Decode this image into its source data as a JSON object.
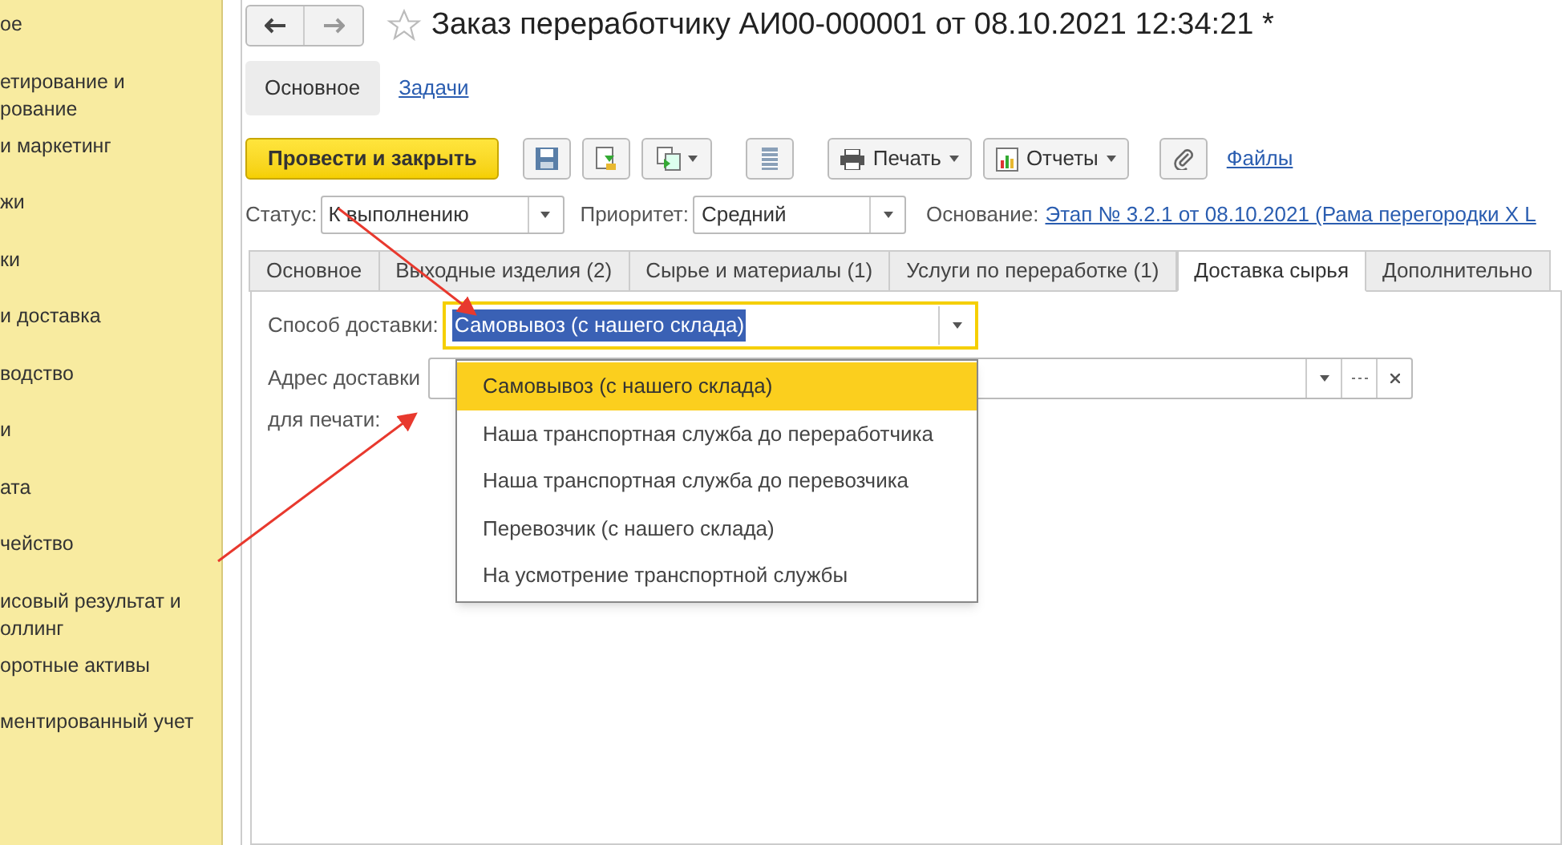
{
  "sidebar": {
    "items": [
      {
        "label": "ое"
      },
      {
        "label": "етирование и рование"
      },
      {
        "label": "и маркетинг"
      },
      {
        "label": "жи"
      },
      {
        "label": "ки"
      },
      {
        "label": "и доставка"
      },
      {
        "label": "водство"
      },
      {
        "label": "и"
      },
      {
        "label": "ата"
      },
      {
        "label": "чейство"
      },
      {
        "label": "исовый результат и оллинг"
      },
      {
        "label": "оротные активы"
      },
      {
        "label": "ментированный учет"
      }
    ]
  },
  "window": {
    "title": "Заказ переработчику АИ00-000001 от 08.10.2021 12:34:21 *"
  },
  "sections": [
    {
      "label": "Основное",
      "selected": true
    },
    {
      "label": "Задачи",
      "selected": false
    }
  ],
  "toolbar": {
    "primary": "Провести и закрыть",
    "print": "Печать",
    "reports": "Отчеты",
    "files": "Файлы"
  },
  "header_fields": {
    "status_label": "Статус:",
    "status": "К выполнению",
    "priority_label": "Приоритет:",
    "priority": "Средний",
    "basis_label": "Основание:",
    "basis": "Этап № 3.2.1 от 08.10.2021 (Рама перегородки X L"
  },
  "tabs": [
    {
      "label": "Основное",
      "selected": false
    },
    {
      "label": "Выходные изделия (2)",
      "selected": false
    },
    {
      "label": "Сырье и материалы (1)",
      "selected": false
    },
    {
      "label": "Услуги по переработке (1)",
      "selected": false
    },
    {
      "label": "Доставка сырья",
      "selected": true
    },
    {
      "label": "Дополнительно",
      "selected": false
    }
  ],
  "form": {
    "delivery_method_label": "Способ доставки:",
    "delivery_method": "Самовывоз (с нашего склада)",
    "address_label": "Адрес доставки",
    "print_label": "для печати:"
  },
  "dropdown": {
    "options": [
      {
        "label": "Самовывоз (с нашего склада)",
        "selected": true
      },
      {
        "label": "Наша транспортная служба до переработчика",
        "selected": false
      },
      {
        "label": "Наша транспортная служба до перевозчика",
        "selected": false
      },
      {
        "label": "Перевозчик (с нашего склада)",
        "selected": false
      },
      {
        "label": "На усмотрение транспортной службы",
        "selected": false
      }
    ]
  }
}
